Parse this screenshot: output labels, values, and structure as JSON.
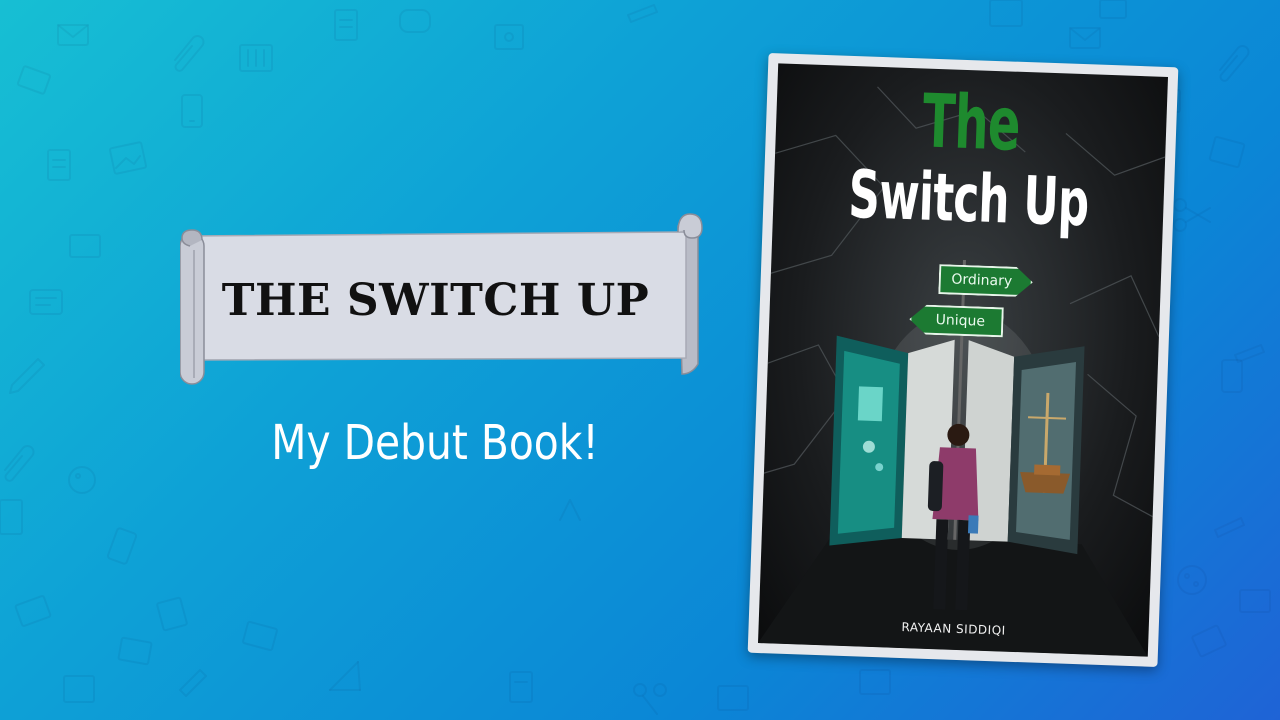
{
  "banner": {
    "title": "THE SWITCH UP"
  },
  "tagline": "My Debut Book!",
  "book": {
    "title_line1": "The",
    "title_line2": "Switch Up",
    "sign_top": "Ordinary",
    "sign_bottom": "Unique",
    "author": "RAYAAN SIDDIQI"
  },
  "colors": {
    "background_start": "#17bfd3",
    "background_end": "#1f63d6",
    "banner_fill": "#d9dce5",
    "cover_title_green": "#1e8a2e",
    "sign_green": "#1c7a32"
  },
  "icons": [
    "envelope-icon",
    "paperclip-icon",
    "phone-icon",
    "document-icon",
    "pencil-icon",
    "scissors-icon",
    "cookie-icon",
    "image-icon",
    "notebook-icon"
  ]
}
